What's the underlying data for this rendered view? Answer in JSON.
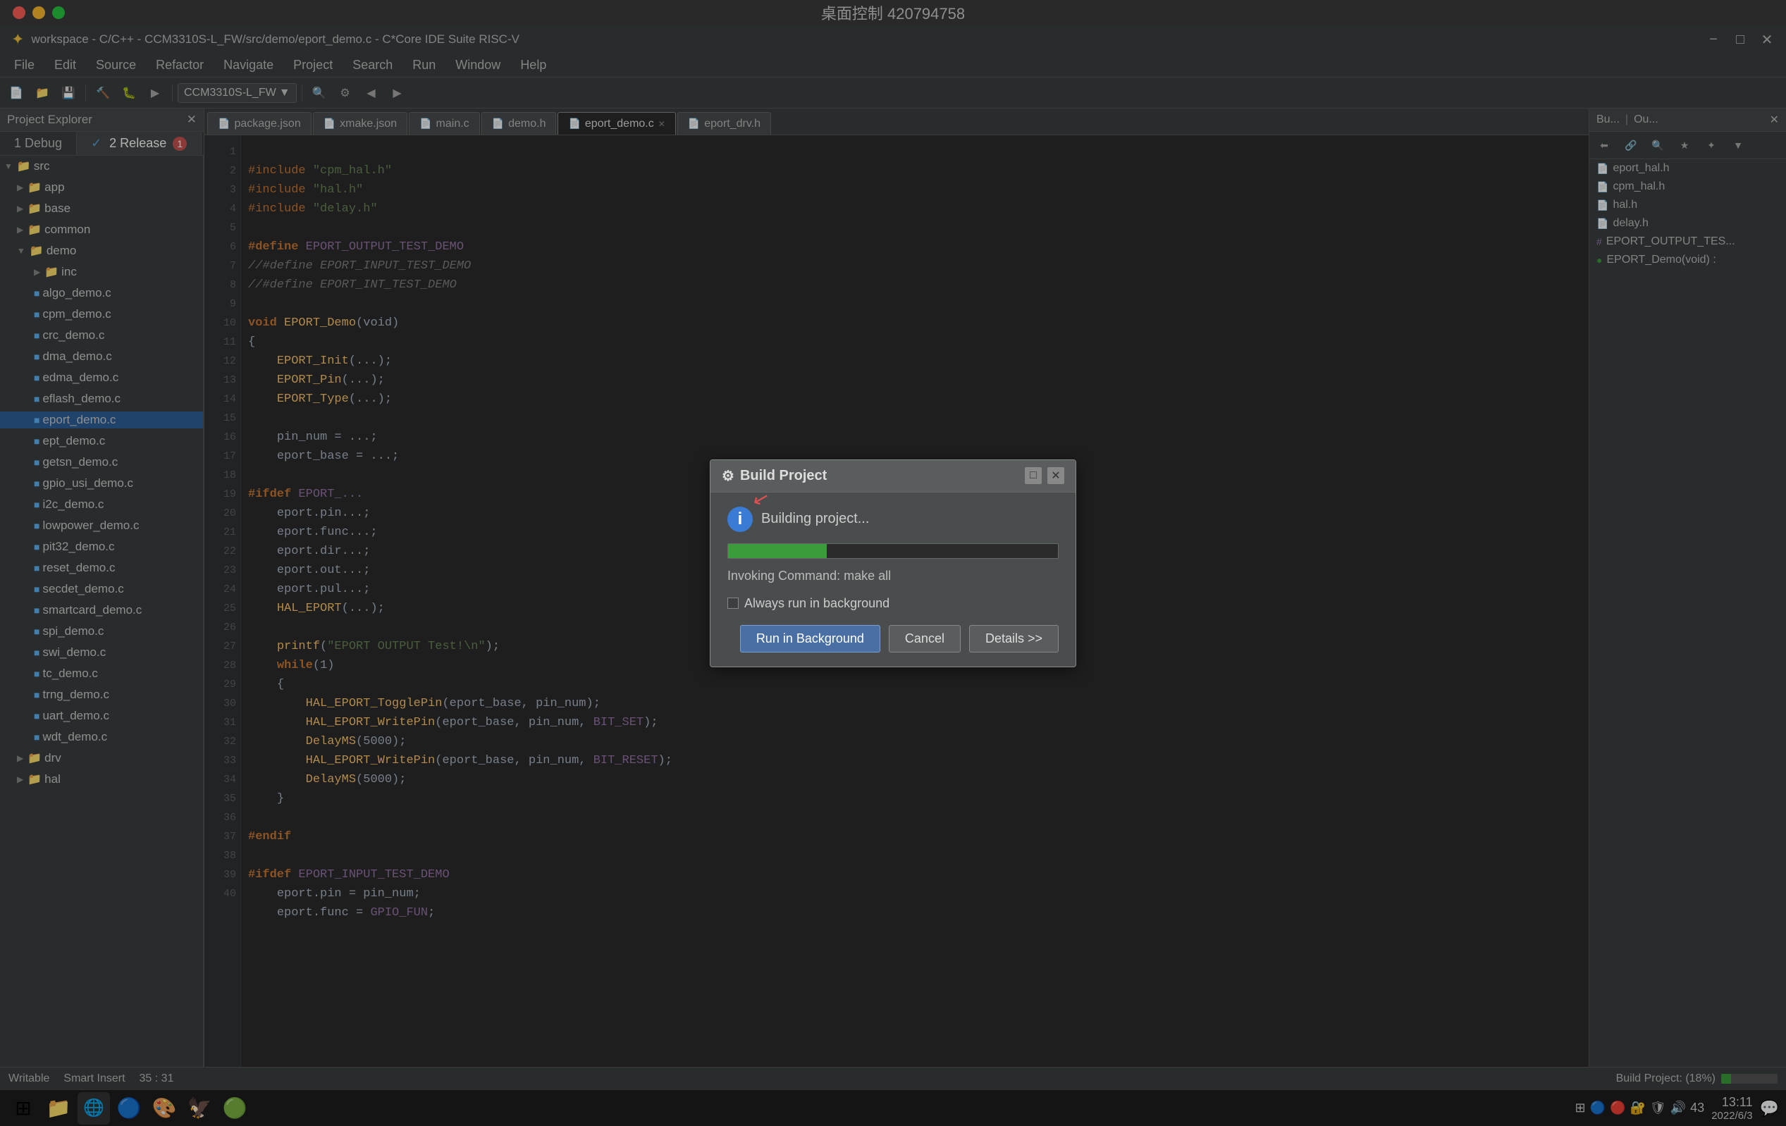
{
  "window": {
    "title_bar": "桌面控制 420794758",
    "app_title": "workspace - C/C++ - CCM3310S-L_FW/src/demo/eport_demo.c - C*Core IDE Suite RISC-V",
    "minimize": "−",
    "maximize": "□",
    "close": "✕"
  },
  "menubar": {
    "items": [
      "File",
      "Edit",
      "Source",
      "Refactor",
      "Navigate",
      "Project",
      "Search",
      "Run",
      "Window",
      "Help"
    ]
  },
  "config_tabs": [
    {
      "label": "1 Debug",
      "active": false
    },
    {
      "label": "2 Release",
      "active": true,
      "badge": "1"
    }
  ],
  "sidebar": {
    "title": "Project Explorer",
    "close_label": "✕",
    "tree": {
      "src": {
        "label": "src",
        "expanded": true,
        "children": {
          "app": {
            "label": "app"
          },
          "base": {
            "label": "base"
          },
          "common": {
            "label": "common"
          },
          "demo": {
            "label": "demo",
            "expanded": true,
            "children": {
              "inc": {
                "label": "inc"
              },
              "algo_demo.c": {
                "label": "algo_demo.c"
              },
              "cpm_demo.c": {
                "label": "cpm_demo.c"
              },
              "crc_demo.c": {
                "label": "crc_demo.c"
              },
              "dma_demo.c": {
                "label": "dma_demo.c"
              },
              "edma_demo.c": {
                "label": "edma_demo.c"
              },
              "eflash_demo.c": {
                "label": "eflash_demo.c"
              },
              "eport_demo.c": {
                "label": "eport_demo.c",
                "selected": true
              },
              "ept_demo.c": {
                "label": "ept_demo.c"
              },
              "getsn_demo.c": {
                "label": "getsn_demo.c"
              },
              "gpio_usi_demo.c": {
                "label": "gpio_usi_demo.c"
              },
              "i2c_demo.c": {
                "label": "i2c_demo.c"
              },
              "lowpower_demo.c": {
                "label": "lowpower_demo.c"
              },
              "pit32_demo.c": {
                "label": "pit32_demo.c"
              },
              "reset_demo.c": {
                "label": "reset_demo.c"
              },
              "secdet_demo.c": {
                "label": "secdet_demo.c"
              },
              "smartcard_demo.c": {
                "label": "smartcard_demo.c"
              },
              "spi_demo.c": {
                "label": "spi_demo.c"
              },
              "swi_demo.c": {
                "label": "swi_demo.c"
              },
              "tc_demo.c": {
                "label": "tc_demo.c"
              },
              "trng_demo.c": {
                "label": "trng_demo.c"
              },
              "uart_demo.c": {
                "label": "uart_demo.c"
              },
              "wdt_demo.c": {
                "label": "wdt_demo.c"
              }
            }
          },
          "drv": {
            "label": "drv"
          },
          "hal": {
            "label": "hal"
          }
        }
      }
    }
  },
  "tabs": [
    {
      "label": "package.json",
      "icon": "📄"
    },
    {
      "label": "xmake.json",
      "icon": "📄"
    },
    {
      "label": "main.c",
      "icon": "📄"
    },
    {
      "label": "demo.h",
      "icon": "📄"
    },
    {
      "label": "eport_demo.c",
      "icon": "📄",
      "active": true
    },
    {
      "label": "eport_drv.h",
      "icon": "📄"
    }
  ],
  "editor": {
    "filename": "eport_demo.c",
    "code_lines": [
      "#include \"cpm_hal.h\"",
      "#include \"hal.h\"",
      "#include \"delay.h\"",
      "",
      "#define EPORT_OUTPUT_TEST_DEMO",
      "//#define EPORT_INPUT_TEST_DEMO",
      "//#define EPORT_INT_TEST_DEMO",
      "",
      "void EPORT_De...",
      "{",
      "    EPORT_Ini...",
      "    EPORT_Pin...",
      "    EPORT_Typ...",
      "",
      "    pin_num = ...",
      "    eport_bas...",
      "",
      "#ifdef EPORT_...",
      "    eport.pin...",
      "    eport.fun...",
      "    eport.dir...",
      "    eport.out...",
      "    eport.pul...",
      "    HAL_EPORT...",
      "",
      "    printf(\"EPORT OUTPUT Test!\\n\");",
      "    while(1)",
      "    {",
      "        HAL_EPORT_TogglePin(eport_base, pin_num);",
      "        HAL_EPORT_WritePin(eport_base, pin_num, BIT_SET);",
      "        DelayMS(5000);",
      "        HAL_EPORT_WritePin(eport_base, pin_num, BIT_RESET);",
      "        DelayMS(5000);",
      "    }",
      "",
      "#endif",
      "",
      "#ifdef EPORT_INPUT_TEST_DEMO",
      "    eport.pin = pin_num;",
      "    eport.func = GPIO_FUN;"
    ]
  },
  "right_panel": {
    "headers": [
      "Bu...",
      "Ou.."
    ],
    "items": [
      {
        "label": "eport_hal.h",
        "icon": "📄"
      },
      {
        "label": "cpm_hal.h",
        "icon": "📄"
      },
      {
        "label": "hal.h",
        "icon": "📄"
      },
      {
        "label": "delay.h",
        "icon": "📄"
      },
      {
        "label": "EPORT_OUTPUT_TES...",
        "icon": "#"
      },
      {
        "label": "EPORT_Demo(void) :",
        "icon": "●"
      }
    ]
  },
  "status_bar": {
    "writable": "Writable",
    "smart_insert": "Smart Insert",
    "position": "35 : 31",
    "build_label": "Build Project: (18%)"
  },
  "dialog": {
    "title": "Build Project",
    "status": "Building project...",
    "progress_percent": 30,
    "invoking": "Invoking Command: make all",
    "checkbox_label": "Always run in background",
    "btn_run_background": "Run in Background",
    "btn_cancel": "Cancel",
    "btn_details": "Details >>"
  },
  "taskbar": {
    "icons": [
      "⊞",
      "📁",
      "🌐",
      "🔵",
      "🎨",
      "🦅",
      "🟢"
    ],
    "time": "13:11",
    "date": "2022/6/3",
    "sys_icons": [
      "⊞",
      "🔵",
      "🔴",
      "🔐",
      "🛡",
      "🔊",
      "43"
    ]
  }
}
